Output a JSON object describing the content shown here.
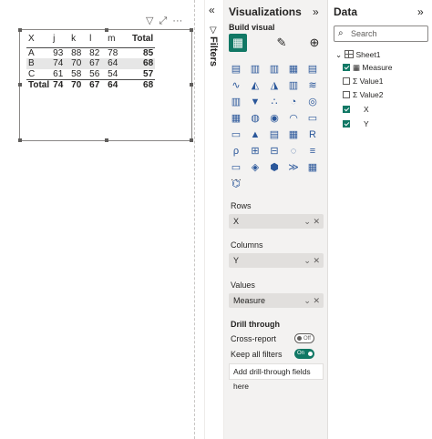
{
  "matrix": {
    "header": [
      "X",
      "j",
      "k",
      "l",
      "m",
      "Total"
    ],
    "rows": [
      {
        "label": "A",
        "values": [
          "93",
          "88",
          "82",
          "78"
        ],
        "total": "85"
      },
      {
        "label": "B",
        "values": [
          "74",
          "70",
          "67",
          "64"
        ],
        "total": "68"
      },
      {
        "label": "C",
        "values": [
          "61",
          "58",
          "56",
          "54"
        ],
        "total": "57"
      }
    ],
    "total_row": {
      "label": "Total",
      "values": [
        "74",
        "70",
        "67",
        "64"
      ],
      "total": "68"
    }
  },
  "filters": {
    "label": "Filters"
  },
  "visualizations": {
    "title": "Visualizations",
    "build_visual": "Build visual",
    "icons": [
      "stacked-bar",
      "clustered-bar",
      "stacked-column",
      "clustered-column",
      "100-bar",
      "line",
      "area",
      "stacked-area",
      "line-column",
      "ribbon",
      "waterfall",
      "funnel",
      "scatter",
      "pie",
      "donut",
      "treemap",
      "map",
      "filled-map",
      "gauge",
      "card",
      "multi-card",
      "kpi",
      "slicer",
      "table",
      "matrix",
      "r-visual",
      "python-visual",
      "key-influencers",
      "decomposition-tree",
      "qa",
      "narrative",
      "paginated",
      "arcgis",
      "power-apps",
      "power-automate",
      "custom"
    ],
    "more": "···",
    "rows_label": "Rows",
    "rows_value": "X",
    "columns_label": "Columns",
    "columns_value": "Y",
    "values_label": "Values",
    "values_value": "Measure",
    "drill_title": "Drill through",
    "cross_report": "Cross-report",
    "cross_report_toggle": "Off",
    "keep_filters": "Keep all filters",
    "keep_filters_toggle": "On",
    "drill_placeholder": "Add drill-through fields here"
  },
  "data_pane": {
    "title": "Data",
    "search_placeholder": "Search",
    "table_name": "Sheet1",
    "fields": [
      {
        "name": "Measure",
        "checked": true,
        "type": "measure"
      },
      {
        "name": "Value1",
        "checked": false,
        "type": "sum"
      },
      {
        "name": "Value2",
        "checked": false,
        "type": "sum"
      },
      {
        "name": "X",
        "checked": true,
        "type": "plain"
      },
      {
        "name": "Y",
        "checked": true,
        "type": "plain"
      }
    ]
  },
  "colors": {
    "accent": "#117865",
    "pane": "#f3f2f1"
  }
}
